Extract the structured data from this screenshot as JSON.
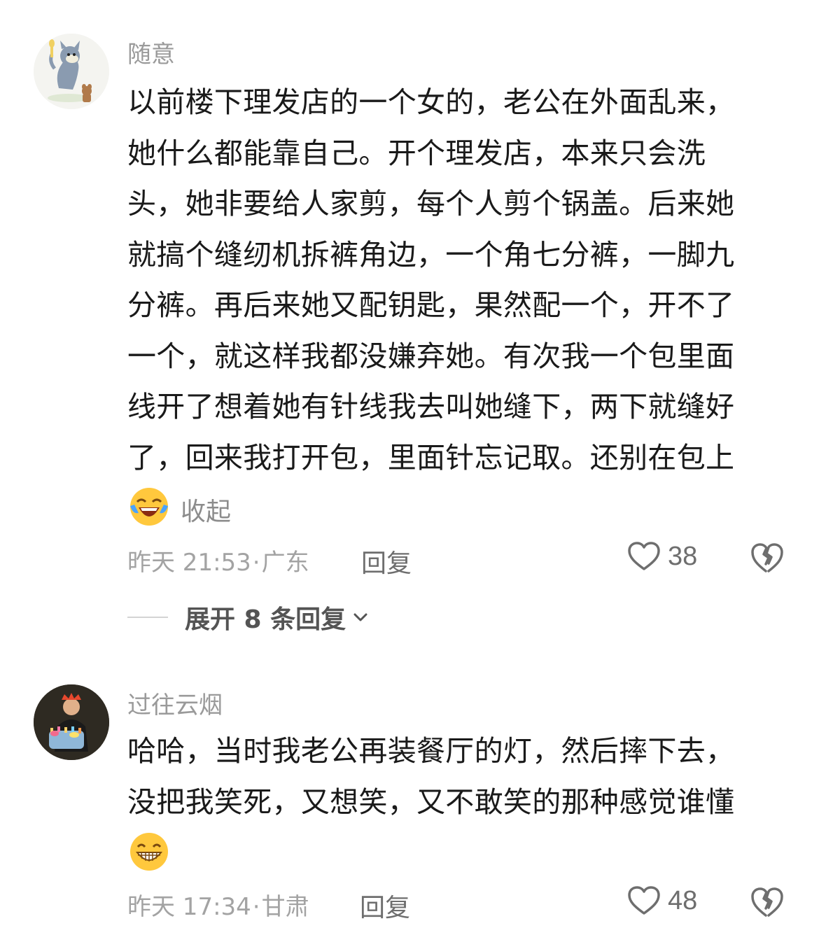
{
  "comments": [
    {
      "username": "随意",
      "body_lines": [
        "以前楼下理发店的一个女的，老公在外面乱来，",
        "她什么都能靠自己。开个理发店，本来只会洗",
        "头，她非要给人家剪，每个人剪个锅盖。后来她",
        "就搞个缝纫机拆裤角边，一个角七分裤，一脚九",
        "分裤。再后来她又配钥匙，果然配一个，开不了",
        "一个，就这样我都没嫌弃她。有次我一个包里面",
        "线开了想着她有针线我去叫她缝下，两下就缝好",
        "了，回来我打开包，里面针忘记取。还别在包上"
      ],
      "emoji": "crying-laughing-emoji",
      "collapse_label": "收起",
      "time": "昨天 21:53",
      "location": "广东",
      "reply_label": "回复",
      "likes": "38",
      "expand_label": "展开 8 条回复"
    },
    {
      "username": "过往云烟",
      "body_lines": [
        "哈哈，当时我老公再装餐厅的灯，然后摔下去，",
        "没把我笑死，又想笑，又不敢笑的那种感觉谁懂"
      ],
      "emoji": "grinning-emoji",
      "time": "昨天 17:34",
      "location": "甘肃",
      "reply_label": "回复",
      "likes": "48"
    }
  ],
  "meta_separator": "·",
  "colors": {
    "text": "#1a1a1a",
    "muted": "#9a9a9a",
    "emoji_yellow": "#ffc83d",
    "tear_blue": "#4aa3ff"
  }
}
